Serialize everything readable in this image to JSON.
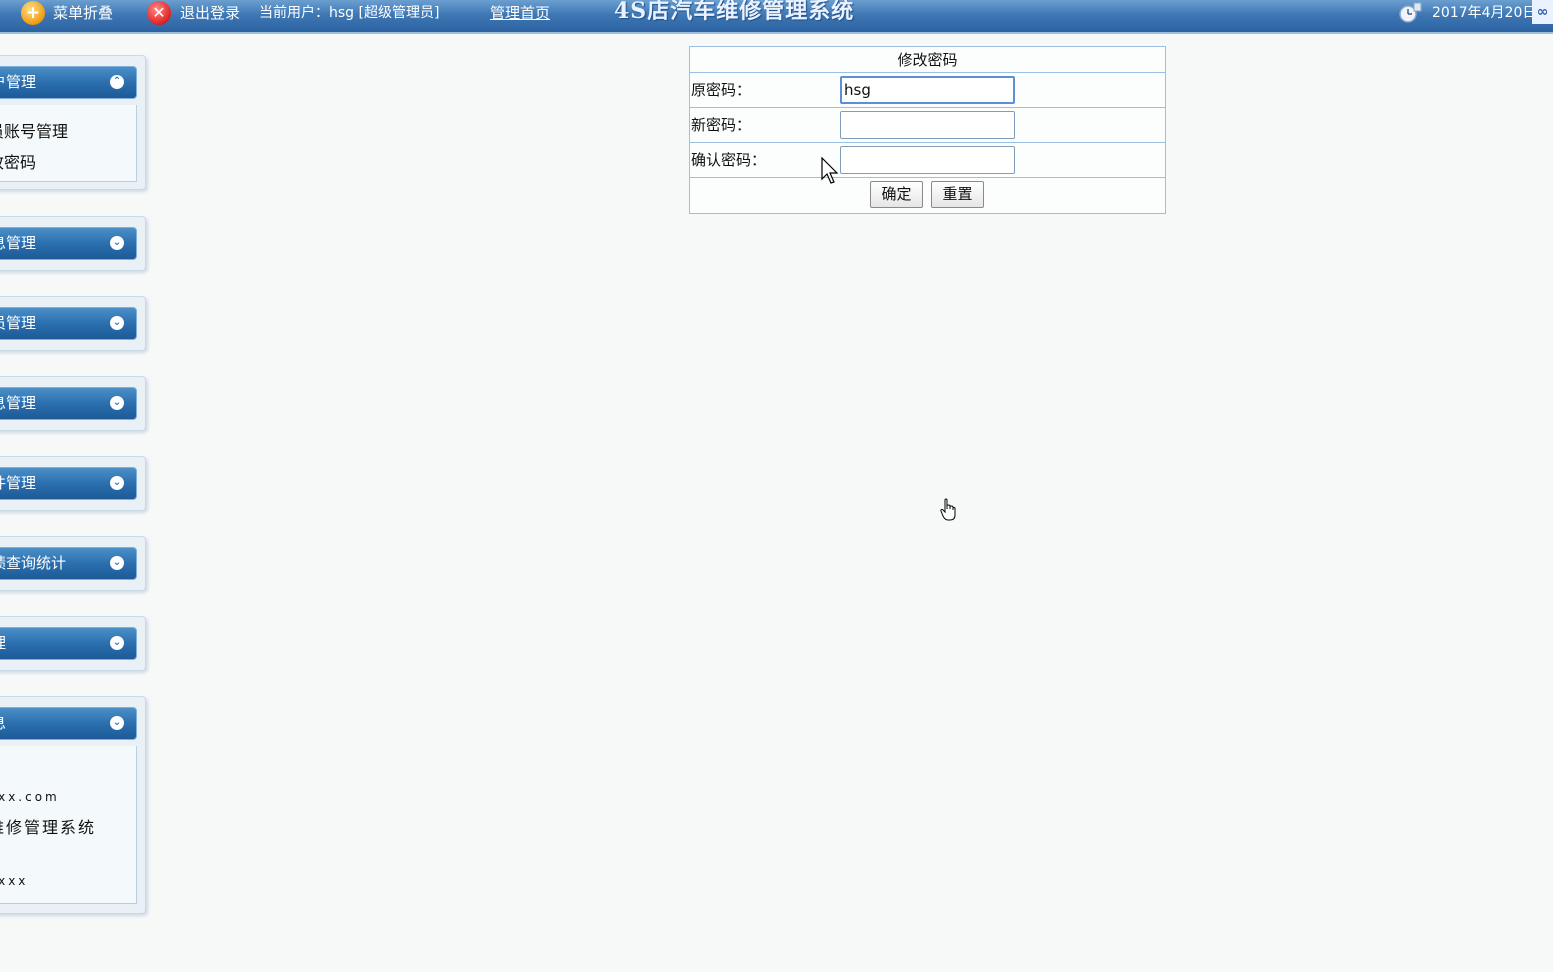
{
  "topbar": {
    "collapse_menu_label": "菜单折叠",
    "logout_label": "退出登录",
    "current_user_text": "当前用户：hsg [超级管理员]",
    "home_link": "管理首页",
    "app_title": "4S店汽车维修管理系统",
    "date_text": "2017年4月20日",
    "icons": {
      "collapse": "plus-circle-icon",
      "logout": "close-circle-icon",
      "clock": "clock-icon",
      "link": "link-icon"
    }
  },
  "sidebar": {
    "panels": [
      {
        "title": "户管理",
        "expanded": true,
        "items": [
          "员账号管理",
          "改密码"
        ]
      },
      {
        "title": "息管理",
        "expanded": false
      },
      {
        "title": "员管理",
        "expanded": false
      },
      {
        "title": "息管理",
        "expanded": false
      },
      {
        "title": "件管理",
        "expanded": false
      },
      {
        "title": "绩查询统计",
        "expanded": false
      },
      {
        "title": "理",
        "expanded": false
      },
      {
        "title": "息",
        "expanded": true,
        "info_lines": [
          ":",
          "xxx.com",
          "维修管理系统",
          ":",
          "xxxx"
        ]
      }
    ],
    "toggle_symbols": {
      "expanded": "⌃",
      "collapsed": "⌄"
    }
  },
  "form": {
    "title": "修改密码",
    "fields": [
      {
        "label": "原密码：",
        "value": "hsg"
      },
      {
        "label": "新密码：",
        "value": ""
      },
      {
        "label": "确认密码：",
        "value": ""
      }
    ],
    "confirm_button": "确定",
    "reset_button": "重置"
  },
  "colors": {
    "topbar": "#3f78b5",
    "panel_header": "#2b6fae",
    "form_border": "#9cbfe6",
    "background": "#f7f9f9"
  }
}
